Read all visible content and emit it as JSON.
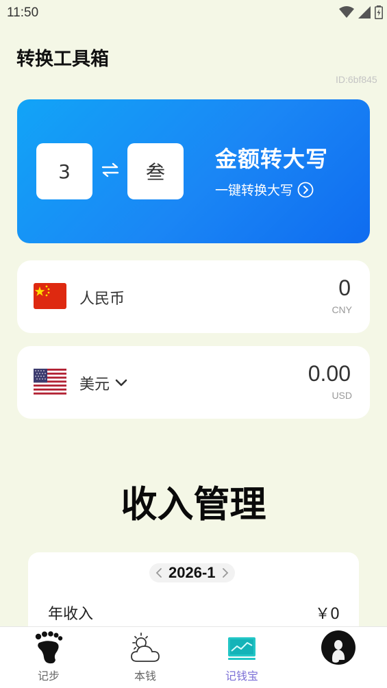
{
  "status_bar": {
    "time": "11:50",
    "icons": [
      "wifi-icon",
      "signal-icon",
      "battery-charging-icon"
    ]
  },
  "page_title": "转换工具箱",
  "id_tag": "ID:6bf845",
  "banner": {
    "digit_input": "3",
    "digit_output": "叁",
    "swap_icon": "swap-arrows-icon",
    "title": "金额转大写",
    "subtitle": "一键转换大写",
    "subtitle_icon": "chevron-right-circle-icon",
    "gradient_start": "#12a4f7",
    "gradient_end": "#0f6cf0"
  },
  "currencies": [
    {
      "name": "人民币",
      "value": "0",
      "code": "CNY",
      "flag": "china-flag-icon",
      "has_dropdown": false
    },
    {
      "name": "美元",
      "value": "0.00",
      "code": "USD",
      "flag": "usa-flag-icon",
      "has_dropdown": true
    }
  ],
  "section_title": "收入管理",
  "income": {
    "period": "2026-1",
    "label": "年收入",
    "value": "￥0"
  },
  "nav": {
    "items": [
      {
        "label": "记步",
        "icon": "footprint-icon",
        "active": false
      },
      {
        "label": "本钱",
        "icon": "weather-cloud-icon",
        "active": false
      },
      {
        "label": "记钱宝",
        "icon": "chart-monitor-icon",
        "active": true
      },
      {
        "label": "",
        "icon": "avatar-icon",
        "active": false
      }
    ],
    "active_color": "#7b6fd6"
  },
  "colors": {
    "page_background": "#f4f7e6",
    "card_background": "#ffffff"
  }
}
